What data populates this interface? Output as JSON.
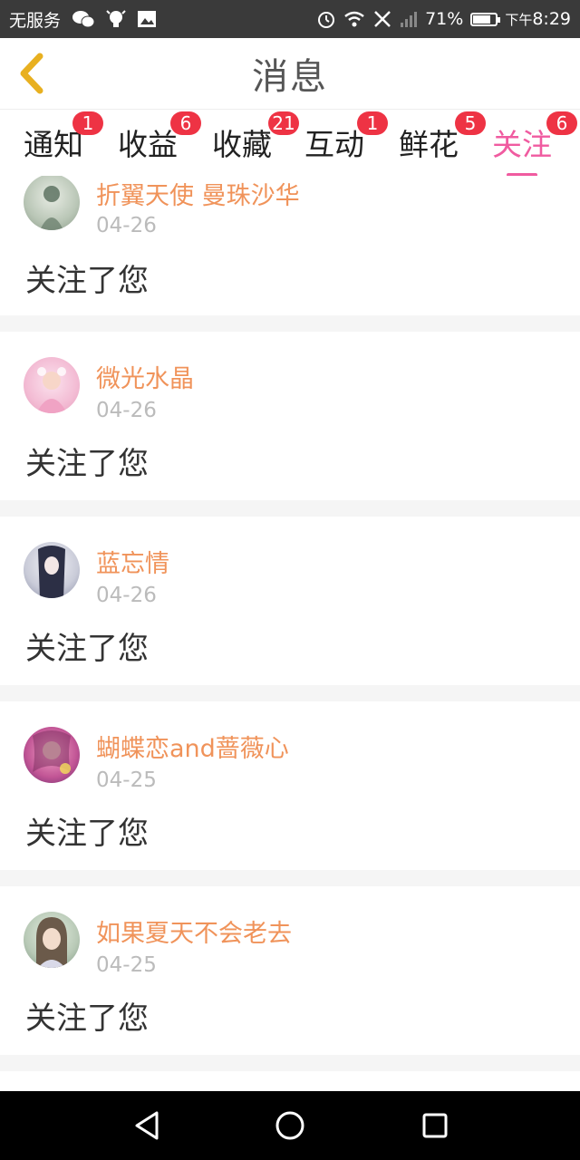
{
  "status_bar": {
    "carrier": "无服务",
    "battery": "71%",
    "time_prefix": "下午",
    "time": "8:29",
    "icons": [
      "wechat-icon",
      "lightbulb-icon",
      "image-icon",
      "alarm-icon",
      "wifi-icon",
      "no-sim-icon",
      "signal-icon",
      "battery-icon"
    ]
  },
  "header": {
    "title": "消息",
    "back_icon": "chevron-left-icon"
  },
  "tabs": [
    {
      "label": "通知",
      "badge": "1",
      "active": false
    },
    {
      "label": "收益",
      "badge": "6",
      "active": false
    },
    {
      "label": "收藏",
      "badge": "21",
      "active": false
    },
    {
      "label": "互动",
      "badge": "1",
      "active": false
    },
    {
      "label": "鲜花",
      "badge": "5",
      "active": false
    },
    {
      "label": "关注",
      "badge": "6",
      "active": true
    }
  ],
  "feed": [
    {
      "name": "折翼天使 曼珠沙华",
      "date": "04-26",
      "message": "关注了您"
    },
    {
      "name": "微光水晶",
      "date": "04-26",
      "message": "关注了您"
    },
    {
      "name": "蓝忘情",
      "date": "04-26",
      "message": "关注了您"
    },
    {
      "name": "蝴蝶恋and蔷薇心",
      "date": "04-25",
      "message": "关注了您"
    },
    {
      "name": "如果夏天不会老去",
      "date": "04-25",
      "message": "关注了您"
    }
  ],
  "colors": {
    "accent": "#f05ba0",
    "name": "#f0935a",
    "badge": "#ee3344",
    "back_icon": "#e8b020"
  },
  "nav_bar": {
    "buttons": [
      "back-triangle-icon",
      "home-circle-icon",
      "recents-square-icon"
    ]
  }
}
